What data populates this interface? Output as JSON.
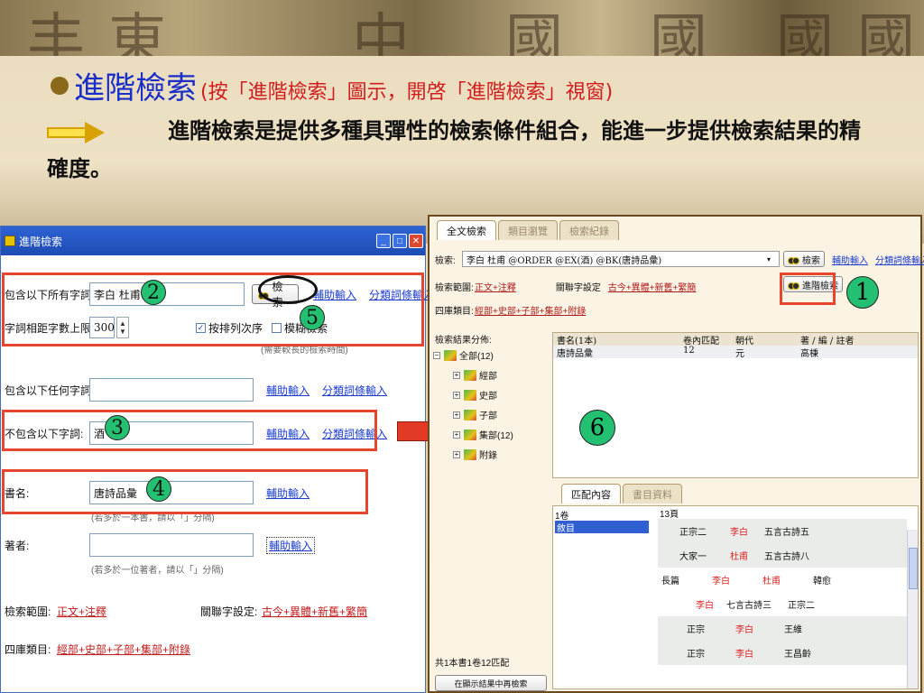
{
  "slide": {
    "heading": "進階檢索",
    "heading_note": "(按「進階檢索」圖示，開啓「進階檢索」視窗)",
    "description": "進階檢索是提供多種具彈性的檢索條件組合，能進一步提供檢索結果的精確度。"
  },
  "callouts": {
    "n1": "1",
    "n2": "2",
    "n3": "3",
    "n4": "4",
    "n5": "5",
    "n6": "6"
  },
  "dialog": {
    "title": "進階檢索",
    "all_words_label": "包含以下所有字詞:",
    "all_words_value": "李白 杜甫",
    "search_button": "檢索",
    "assist_input": "輔助輸入",
    "category_input": "分類詞條輸入",
    "distance_label": "字詞相距字數上限:",
    "distance_value": "300",
    "ordered_label": "按排列次序",
    "fuzzy_label": "模糊檢索",
    "fuzzy_hint": "(需要較長的檢索時間)",
    "any_words_label": "包含以下任何字詞:",
    "exclude_label": "不包含以下字詞:",
    "exclude_value": "酒",
    "book_label": "書名:",
    "book_value": "唐詩品彙",
    "book_hint": "(若多於一本書，請以「」分隔)",
    "author_label": "著者:",
    "author_hint": "(若多於一位著者，請以「」分隔)",
    "scope_label": "檢索範圍:",
    "scope_value": "正文+注釋",
    "related_label": "關聯字設定:",
    "related_value": "古今+異體+新舊+繁簡",
    "category_label": "四庫類目:",
    "category_value": "經部+史部+子部+集部+附錄"
  },
  "result_panel": {
    "tabs": [
      "全文檢索",
      "類目瀏覽",
      "檢索紀錄"
    ],
    "search_label": "檢索:",
    "query": "李白 杜甫 @ORDER @EX(酒) @BK(唐詩品彙)",
    "search_button": "檢索",
    "assist_input": "輔助輸入",
    "category_input": "分類詞條輸入",
    "scope_label": "檢索範圍:",
    "scope_value": "正文+注釋",
    "related_label": "關聯字設定",
    "related_value": "古今+異體+新舊+繁簡",
    "advanced_button": "進階檢索",
    "category_label": "四庫類目:",
    "category_value": "經部+史部+子部+集部+附錄",
    "tree_label": "檢索結果分佈:",
    "tree": [
      {
        "label": "全部(12)"
      },
      {
        "label": "經部"
      },
      {
        "label": "史部"
      },
      {
        "label": "子部"
      },
      {
        "label": "集部(12)"
      },
      {
        "label": "附錄"
      }
    ],
    "columns": [
      "書名(1本)",
      "卷內匹配",
      "朝代",
      "著 / 編 / 註者"
    ],
    "rows": [
      {
        "book": "唐詩品彙",
        "matches": "12",
        "dynasty": "元",
        "author": "高棅"
      }
    ],
    "lower_tabs": [
      "匹配內容",
      "書目資料"
    ],
    "volume_label": "1卷",
    "volume_item": "敘目",
    "page_label": "13頁",
    "verses": [
      [
        "正宗二",
        "李白",
        "五言古詩五"
      ],
      [
        "大家一",
        "杜甫",
        "五言古詩八"
      ],
      [
        "長篇",
        "李白",
        "杜甫",
        "韓愈"
      ],
      [
        "李白",
        "七言古詩三",
        "正宗二"
      ],
      [
        "正宗",
        "李白",
        "王維"
      ],
      [
        "正宗",
        "李白",
        "王昌齡"
      ]
    ],
    "status": "共1本書1卷12匹配",
    "bottom_button": "在顯示結果中再檢索"
  },
  "colors": {
    "heading": "#1a2fc9",
    "note": "#d11d1d",
    "highlight_box": "#e5462d",
    "callout": "#24c071"
  }
}
